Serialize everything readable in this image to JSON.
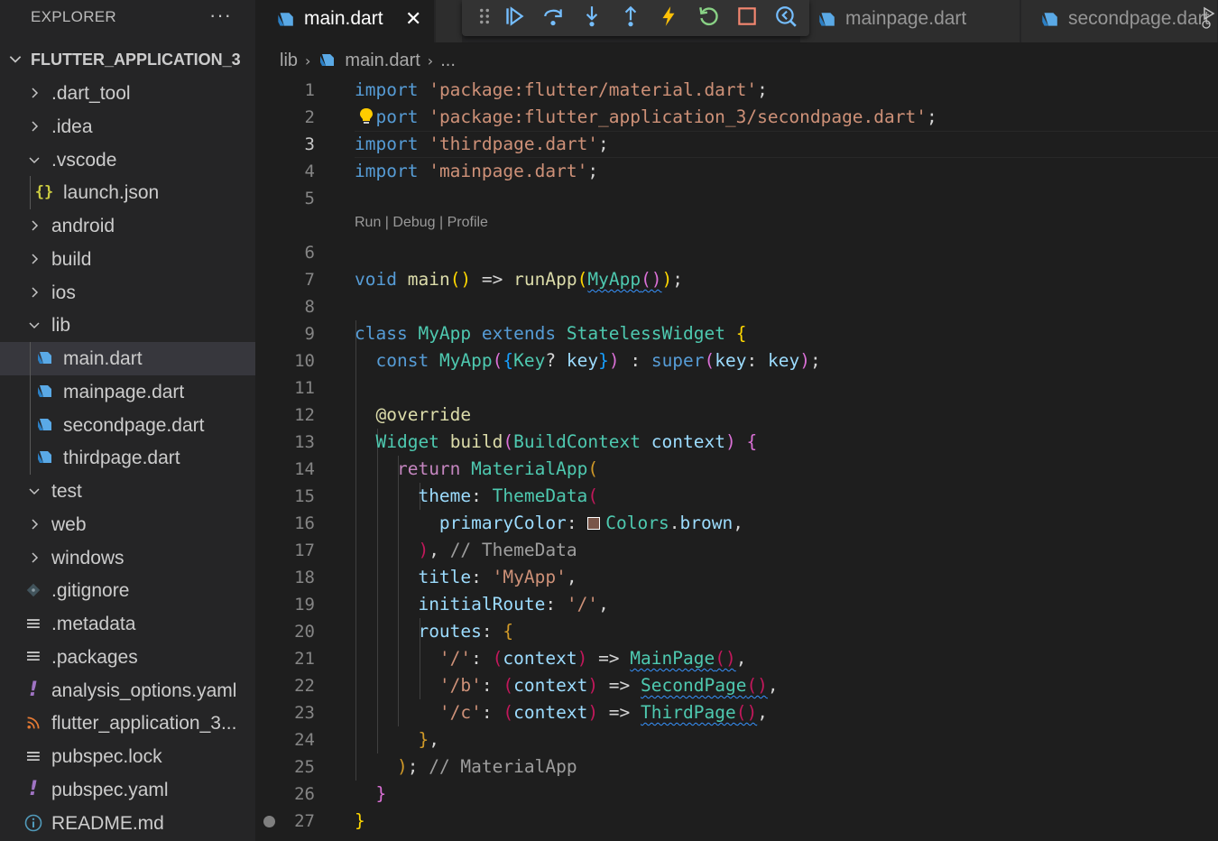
{
  "sidebar": {
    "title": "EXPLORER",
    "more": "···",
    "project": "FLUTTER_APPLICATION_3",
    "items": [
      {
        "label": ".dart_tool",
        "kind": "folder",
        "expanded": false,
        "icon": "chevron-right-icon"
      },
      {
        "label": ".idea",
        "kind": "folder",
        "expanded": false,
        "icon": "chevron-right-icon"
      },
      {
        "label": ".vscode",
        "kind": "folder",
        "expanded": true,
        "icon": "chevron-down-icon"
      },
      {
        "label": "launch.json",
        "kind": "file",
        "icon": "json-icon",
        "glyph": "{}"
      },
      {
        "label": "android",
        "kind": "folder",
        "expanded": false,
        "icon": "chevron-right-icon"
      },
      {
        "label": "build",
        "kind": "folder",
        "expanded": false,
        "icon": "chevron-right-icon"
      },
      {
        "label": "ios",
        "kind": "folder",
        "expanded": false,
        "icon": "chevron-right-icon"
      },
      {
        "label": "lib",
        "kind": "folder",
        "expanded": true,
        "icon": "chevron-down-icon"
      },
      {
        "label": "main.dart",
        "kind": "file",
        "icon": "dart-icon",
        "selected": true
      },
      {
        "label": "mainpage.dart",
        "kind": "file",
        "icon": "dart-icon"
      },
      {
        "label": "secondpage.dart",
        "kind": "file",
        "icon": "dart-icon"
      },
      {
        "label": "thirdpage.dart",
        "kind": "file",
        "icon": "dart-icon"
      },
      {
        "label": "test",
        "kind": "folder",
        "expanded": true,
        "icon": "chevron-down-icon"
      },
      {
        "label": "web",
        "kind": "folder",
        "expanded": false,
        "icon": "chevron-right-icon"
      },
      {
        "label": "windows",
        "kind": "folder",
        "expanded": false,
        "icon": "chevron-right-icon"
      },
      {
        "label": ".gitignore",
        "kind": "file",
        "icon": "git-icon"
      },
      {
        "label": ".metadata",
        "kind": "file",
        "icon": "lines-icon",
        "glyph": "≡"
      },
      {
        "label": ".packages",
        "kind": "file",
        "icon": "lines-icon",
        "glyph": "≡"
      },
      {
        "label": "analysis_options.yaml",
        "kind": "file",
        "icon": "yaml-icon",
        "glyph": "!"
      },
      {
        "label": "flutter_application_3...",
        "kind": "file",
        "icon": "rss-icon"
      },
      {
        "label": "pubspec.lock",
        "kind": "file",
        "icon": "lines-icon",
        "glyph": "≡"
      },
      {
        "label": "pubspec.yaml",
        "kind": "file",
        "icon": "yaml-icon",
        "glyph": "!"
      },
      {
        "label": "README.md",
        "kind": "file",
        "icon": "info-icon",
        "glyph": "i"
      }
    ]
  },
  "tabs": [
    {
      "label": "main.dart",
      "active": true,
      "close": "✕"
    },
    {
      "label": "mainpage.dart",
      "active": false
    },
    {
      "label": "secondpage.dart",
      "active": false
    }
  ],
  "debug_toolbar": [
    "drag-handle-icon",
    "continue-icon",
    "step-over-icon",
    "step-into-icon",
    "step-out-icon",
    "hot-reload-icon",
    "restart-icon",
    "stop-icon",
    "devtools-icon"
  ],
  "breadcrumb": {
    "folder": "lib",
    "file": "main.dart",
    "more": "..."
  },
  "editor": {
    "codelens": "Run | Debug | Profile",
    "current_line": 3,
    "line_numbers": [
      "1",
      "2",
      "3",
      "4",
      "5",
      "6",
      "7",
      "8",
      "9",
      "10",
      "11",
      "12",
      "13",
      "14",
      "15",
      "16",
      "17",
      "18",
      "19",
      "20",
      "21",
      "22",
      "23",
      "24",
      "25",
      "26",
      "27"
    ],
    "code": {
      "l1": {
        "kw": "import",
        "str": "'package:flutter/material.dart'",
        "end": ";"
      },
      "l2": {
        "kw": "port",
        "str": "'package:flutter_application_3/secondpage.dart'",
        "end": ";"
      },
      "l3": {
        "kw": "import",
        "str": "'thirdpage.dart'",
        "end": ";"
      },
      "l4": {
        "kw": "import",
        "str": "'mainpage.dart'",
        "end": ";"
      },
      "l6": {
        "kw": "void",
        "fn": "main",
        "arrow": "=>",
        "call": "runApp",
        "cls": "MyApp"
      },
      "l8": {
        "kw": "class",
        "cls": "MyApp",
        "ext": "extends",
        "base": "StatelessWidget"
      },
      "l9": {
        "kw": "const",
        "cls": "MyApp",
        "type": "Key",
        "prm": "key",
        "sup": "super"
      },
      "l11": {
        "ann": "@override"
      },
      "l12": {
        "cls": "Widget",
        "fn": "build",
        "type": "BuildContext",
        "prm": "context"
      },
      "l13": {
        "kw": "return",
        "cls": "MaterialApp"
      },
      "l14": {
        "prm": "theme",
        "cls": "ThemeData"
      },
      "l15": {
        "prm": "primaryColor",
        "cls": "Colors",
        "val": "brown",
        "swatch": "#795548"
      },
      "l16": {
        "cmt": "// ThemeData"
      },
      "l17": {
        "prm": "title",
        "str": "'MyApp'"
      },
      "l18": {
        "prm": "initialRoute",
        "str": "'/'"
      },
      "l19": {
        "prm": "routes"
      },
      "l20": {
        "str": "'/'",
        "prm": "context",
        "cls": "MainPage"
      },
      "l21": {
        "str": "'/b'",
        "prm": "context",
        "cls": "SecondPage"
      },
      "l22": {
        "str": "'/c'",
        "prm": "context",
        "cls": "ThirdPage"
      },
      "l24": {
        "cmt": "// MaterialApp"
      }
    }
  }
}
